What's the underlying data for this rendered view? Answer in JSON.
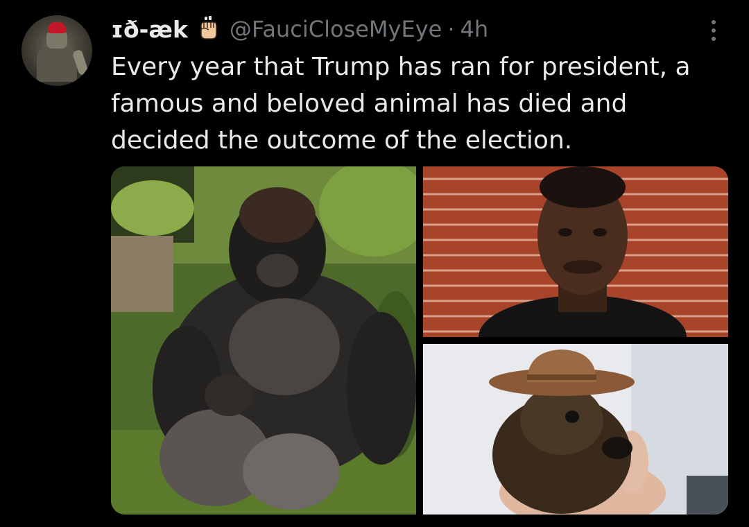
{
  "author": {
    "display_name": "ɪð-æk",
    "handle": "@FauciCloseMyEye",
    "separator": "·",
    "time": "4h",
    "badge_icon": "raised-fist-icon"
  },
  "tweet": {
    "lines": [
      "Every year that Trump has ran for president, a",
      "famous and beloved animal has died and",
      "decided the outcome of the election."
    ]
  },
  "media": {
    "images": [
      {
        "subject": "gorilla-photo"
      },
      {
        "subject": "man-portrait-photo"
      },
      {
        "subject": "squirrel-cowboy-hat-photo"
      }
    ]
  },
  "colors": {
    "background": "#000000",
    "primary_text": "#e7e9ea",
    "secondary_text": "#71767b"
  }
}
